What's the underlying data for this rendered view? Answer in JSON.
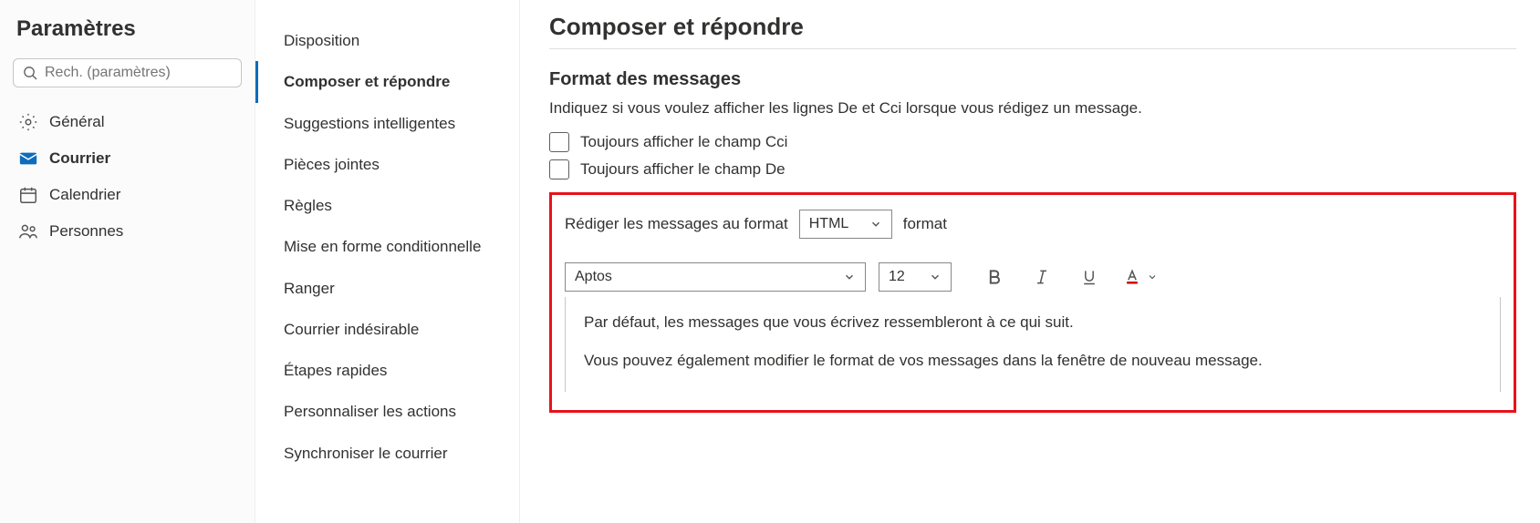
{
  "sidebar": {
    "title": "Paramètres",
    "search_placeholder": "Rech. (paramètres)",
    "items": [
      {
        "label": "Général",
        "icon": "gear"
      },
      {
        "label": "Courrier",
        "icon": "mail"
      },
      {
        "label": "Calendrier",
        "icon": "calendar"
      },
      {
        "label": "Personnes",
        "icon": "people"
      }
    ]
  },
  "subnav": {
    "items": [
      "Disposition",
      "Composer et répondre",
      "Suggestions intelligentes",
      "Pièces jointes",
      "Règles",
      "Mise en forme conditionnelle",
      "Ranger",
      "Courrier indésirable",
      "Étapes rapides",
      "Personnaliser les actions",
      "Synchroniser le courrier"
    ]
  },
  "main": {
    "title": "Composer et répondre",
    "section_title": "Format des messages",
    "section_desc": "Indiquez si vous voulez afficher les lignes De et Cci lorsque vous rédigez un message.",
    "check_bcc": "Toujours afficher le champ Cci",
    "check_from": "Toujours afficher le champ De",
    "compose_prefix": "Rédiger les messages au format",
    "compose_format": "HTML",
    "compose_suffix": "format",
    "font_name": "Aptos",
    "font_size": "12",
    "preview_line1": "Par défaut, les messages que vous écrivez ressembleront à ce qui suit.",
    "preview_line2": "Vous pouvez également modifier le format de vos messages dans la fenêtre de nouveau message."
  }
}
